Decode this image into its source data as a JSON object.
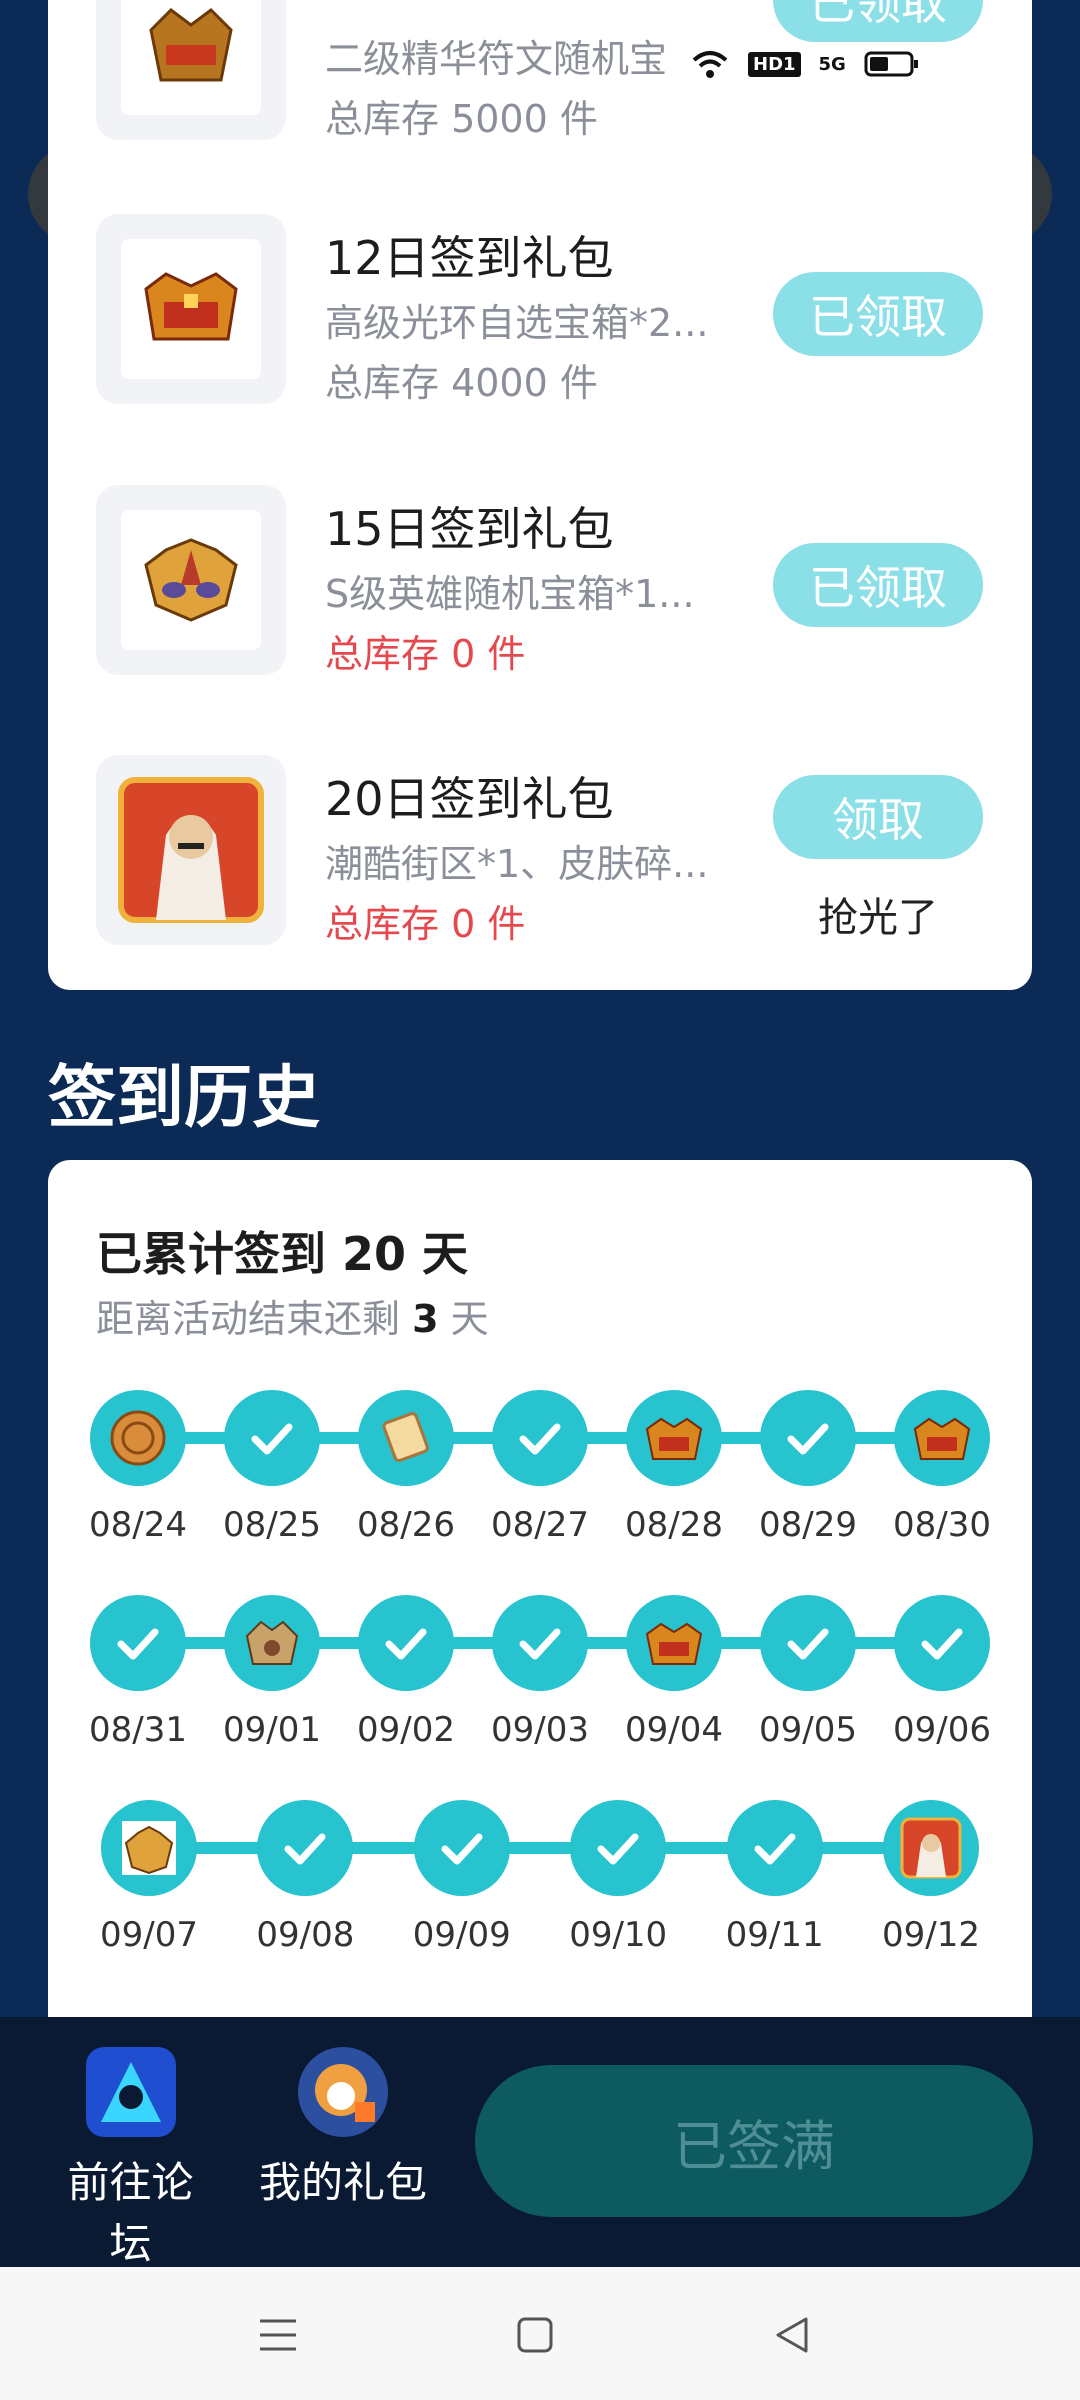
{
  "rewards": [
    {
      "title": "",
      "desc": "二级精华符文随机宝",
      "stock": "总库存 5000 件",
      "stock_red": false,
      "button": "已领取",
      "note": ""
    },
    {
      "title": "12日签到礼包",
      "desc": "高级光环自选宝箱*2...",
      "stock": "总库存 4000 件",
      "stock_red": false,
      "button": "已领取",
      "note": ""
    },
    {
      "title": "15日签到礼包",
      "desc": "S级英雄随机宝箱*1...",
      "stock": "总库存 0 件",
      "stock_red": true,
      "button": "已领取",
      "note": ""
    },
    {
      "title": "20日签到礼包",
      "desc": "潮酷街区*1、皮肤碎...",
      "stock": "总库存 0 件",
      "stock_red": true,
      "button": "领取",
      "note": "抢光了"
    }
  ],
  "history": {
    "title": "签到历史",
    "days_prefix": "已累计签到 ",
    "days_value": "20",
    "days_suffix": " 天",
    "remain_prefix": "距离活动结束还剩 ",
    "remain_value": "3",
    "remain_suffix": " 天",
    "rows": [
      {
        "dates": [
          "08/24",
          "08/25",
          "08/26",
          "08/27",
          "08/28",
          "08/29",
          "08/30"
        ],
        "icons": [
          "coin-reward-icon",
          "check-icon",
          "scroll-reward-icon",
          "check-icon",
          "chest-reward-icon",
          "check-icon",
          "chest-reward-icon"
        ]
      },
      {
        "dates": [
          "08/31",
          "09/01",
          "09/02",
          "09/03",
          "09/04",
          "09/05",
          "09/06"
        ],
        "icons": [
          "check-icon",
          "crest-reward-icon",
          "check-icon",
          "check-icon",
          "chest-reward-icon",
          "check-icon",
          "check-icon"
        ]
      },
      {
        "dates": [
          "09/07",
          "09/08",
          "09/09",
          "09/10",
          "09/11",
          "09/12"
        ],
        "icons": [
          "mask-reward-icon",
          "check-icon",
          "check-icon",
          "check-icon",
          "check-icon",
          "hero-reward-icon"
        ]
      }
    ]
  },
  "bottom": {
    "forum": "前往论坛",
    "mygift": "我的礼包",
    "signed_full": "已签满"
  },
  "status": {
    "hd": "HD1",
    "net": "5G"
  }
}
